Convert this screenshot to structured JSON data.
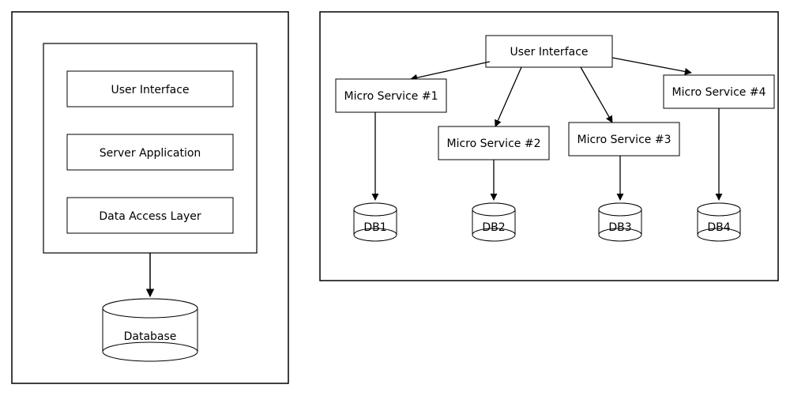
{
  "monolith": {
    "layers": [
      "User Interface",
      "Server Application",
      "Data Access Layer"
    ],
    "database": "Database"
  },
  "microservices": {
    "ui": "User Interface",
    "services": [
      "Micro Service #1",
      "Micro Service #2",
      "Micro Service #3",
      "Micro Service #4"
    ],
    "databases": [
      "DB1",
      "DB2",
      "DB3",
      "DB4"
    ]
  }
}
